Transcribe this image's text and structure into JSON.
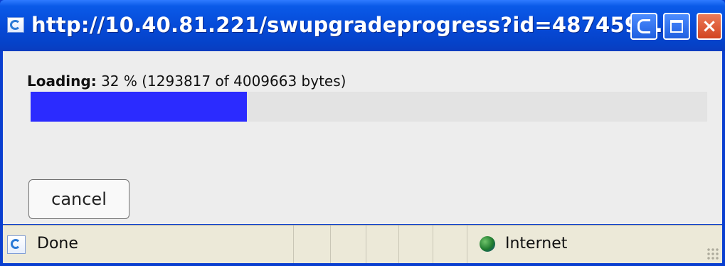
{
  "window": {
    "title": "http://10.40.81.221/swupgradeprogress?id=487459...",
    "title_icon": "ie-page-icon",
    "controls": [
      "minimize-icon",
      "maximize-icon",
      "close-icon"
    ],
    "colors": {
      "titlebar": "#0649d6",
      "close": "#d24420"
    }
  },
  "progress": {
    "label": "Loading:",
    "detail": "32 % (1293817 of 4009663 bytes)",
    "percent": 32,
    "bytes_loaded": 1293817,
    "bytes_total": 4009663,
    "bar_color": "#2b2bff"
  },
  "actions": {
    "cancel_label": "cancel"
  },
  "statusbar": {
    "status_text": "Done",
    "zone_text": "Internet",
    "status_icon": "ie-page-icon",
    "zone_icon": "globe-icon"
  }
}
